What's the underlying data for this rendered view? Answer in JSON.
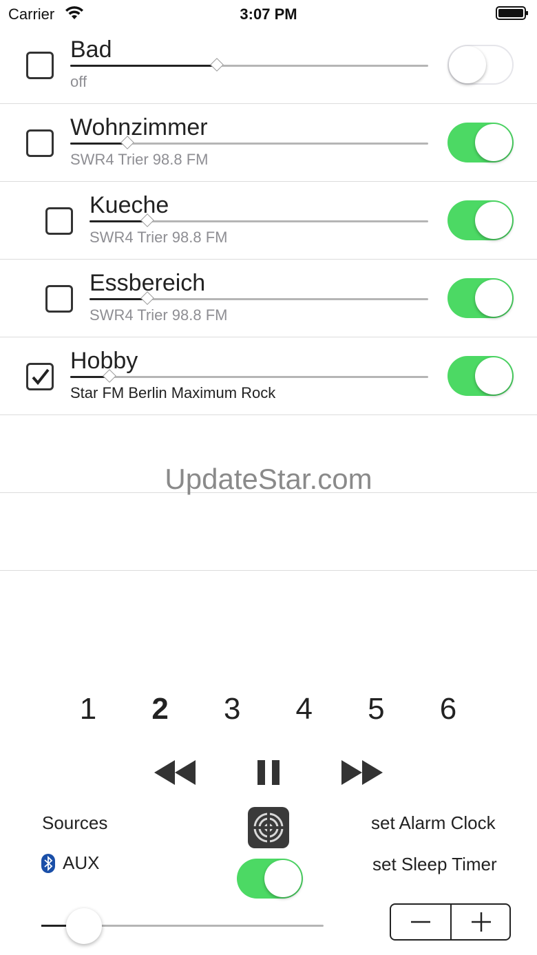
{
  "status_bar": {
    "carrier": "Carrier",
    "time": "3:07 PM"
  },
  "rooms": [
    {
      "name": "Bad",
      "source": "off",
      "checked": false,
      "power_on": false,
      "volume": 0.41,
      "indent": false
    },
    {
      "name": "Wohnzimmer",
      "source": "SWR4 Trier 98.8 FM",
      "checked": false,
      "power_on": true,
      "volume": 0.16,
      "indent": false
    },
    {
      "name": "Kueche",
      "source": "SWR4 Trier 98.8 FM",
      "checked": false,
      "power_on": true,
      "volume": 0.17,
      "indent": true
    },
    {
      "name": "Essbereich",
      "source": "SWR4 Trier 98.8 FM",
      "checked": false,
      "power_on": true,
      "volume": 0.17,
      "indent": true
    },
    {
      "name": "Hobby",
      "source": "Star FM Berlin Maximum Rock",
      "checked": true,
      "power_on": true,
      "volume": 0.11,
      "indent": false
    }
  ],
  "watermark": "UpdateStar.com",
  "presets": {
    "items": [
      "1",
      "2",
      "3",
      "4",
      "5",
      "6"
    ],
    "selected": "2"
  },
  "transport": {
    "rewind_icon": "rewind-icon",
    "pause_icon": "pause-icon",
    "forward_icon": "fast-forward-icon"
  },
  "controls": {
    "sources_label": "Sources",
    "aux_label": "AUX",
    "alarm_label": "set Alarm Clock",
    "sleep_label": "set Sleep Timer",
    "master_power_on": true,
    "master_volume": 0.15,
    "stepper_minus": "−",
    "stepper_plus": "+"
  },
  "colors": {
    "toggle_on": "#4cd964",
    "bluetooth": "#1a4fa8"
  }
}
